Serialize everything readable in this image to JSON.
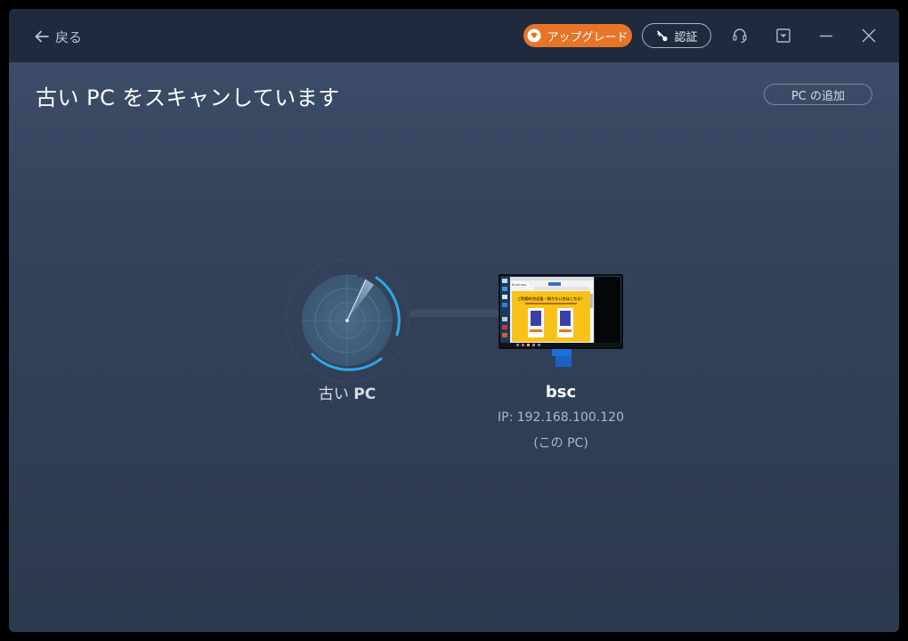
{
  "header": {
    "back_label": "戻る",
    "upgrade_label": "アップグレード",
    "auth_label": "認証"
  },
  "main": {
    "title": "古い PC をスキャンしています",
    "add_pc_label": "PC の追加",
    "old_pc_prefix": "古い",
    "old_pc_suffix": "PC",
    "target_pc": {
      "name": "bsc",
      "ip": "IP: 192.168.100.120",
      "note": "(この PC)"
    }
  },
  "screen_thumbnail": {
    "site_name": "Buisiness",
    "banner_text": "ご利用の方広告・知りたい方はこちら！"
  },
  "icons": {
    "back": "arrow-left-icon",
    "upgrade": "diamond-icon",
    "auth": "key-icon",
    "support": "headset-icon",
    "menu": "dropdown-menu-icon",
    "minimize": "minimize-icon",
    "close": "close-icon",
    "scan": "radar-icon",
    "pc": "monitor-icon"
  },
  "colors": {
    "accent_orange": "#e8742a",
    "radar_blue": "#2ea8e8",
    "titlebar": "#1f2a3c"
  }
}
